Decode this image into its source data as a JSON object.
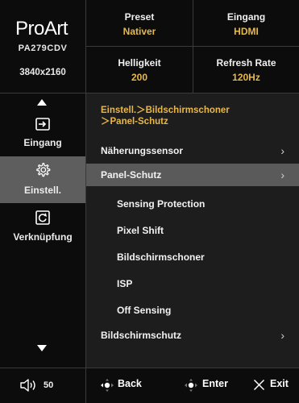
{
  "brand": {
    "logo": "ProArt",
    "model": "PA279CDV",
    "resolution": "3840x2160"
  },
  "status": {
    "preset": {
      "label": "Preset",
      "value": "Nativer"
    },
    "input": {
      "label": "Eingang",
      "value": "HDMI"
    },
    "brightness": {
      "label": "Helligkeit",
      "value": "200"
    },
    "refresh": {
      "label": "Refresh Rate",
      "value": "120Hz"
    }
  },
  "nav": {
    "items": [
      {
        "label": "Eingang",
        "icon": "input-icon",
        "active": false
      },
      {
        "label": "Einstell.",
        "icon": "settings-gear-icon",
        "active": true
      },
      {
        "label": "Verknüpfung",
        "icon": "shortcut-icon",
        "active": false
      }
    ]
  },
  "panel": {
    "breadcrumb_line1": "Einstell.＞Bildschirmschoner",
    "breadcrumb_line2": "＞Panel-Schutz",
    "rows": [
      {
        "label": "Näherungssensor",
        "chevron": "›",
        "active": false,
        "sub": false
      },
      {
        "label": "Panel-Schutz",
        "chevron": "›",
        "active": true,
        "sub": false
      },
      {
        "label": "Sensing Protection",
        "chevron": "",
        "active": false,
        "sub": true
      },
      {
        "label": "Pixel Shift",
        "chevron": "",
        "active": false,
        "sub": true
      },
      {
        "label": "Bildschirmschoner",
        "chevron": "",
        "active": false,
        "sub": true
      },
      {
        "label": "ISP",
        "chevron": "",
        "active": false,
        "sub": true
      },
      {
        "label": "Off Sensing",
        "chevron": "",
        "active": false,
        "sub": true
      },
      {
        "label": "Bildschirmschutz",
        "chevron": "›",
        "active": false,
        "sub": false
      }
    ]
  },
  "footer": {
    "volume": "50",
    "back": "Back",
    "enter": "Enter",
    "exit": "Exit"
  },
  "colors": {
    "accent": "#e8b84b",
    "active_bg": "#5a5a5a",
    "panel_bg": "#1d1d1d",
    "frame_bg": "#0c0c0c"
  }
}
